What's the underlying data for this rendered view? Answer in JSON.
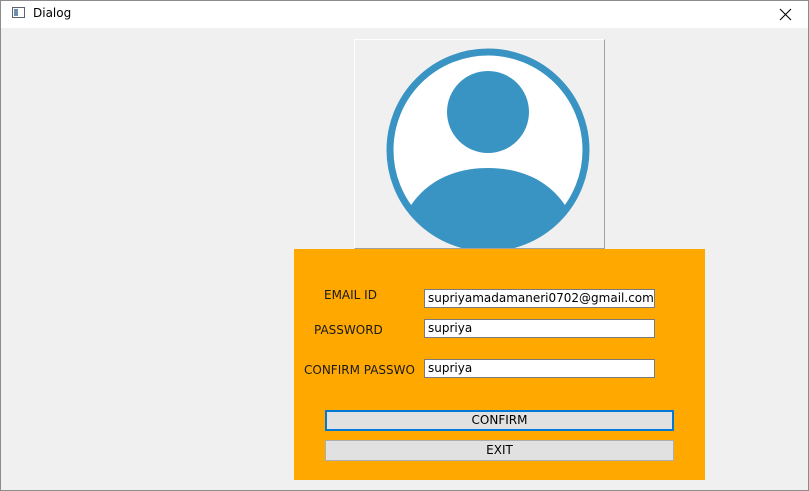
{
  "window": {
    "title": "Dialog",
    "close_glyph": "close-icon"
  },
  "avatar": {
    "icon": "user-avatar-icon",
    "color": "#3a94c3"
  },
  "form": {
    "background": "#ffa800",
    "email_label": "EMAIL ID",
    "email_value": "supriyamadamaneri0702@gmail.com",
    "password_label": "PASSWORD",
    "password_value": "supriya",
    "confirm_label": "CONFIRM PASSWORD",
    "confirm_value": "supriya",
    "confirm_button": "CONFIRM",
    "exit_button": "EXIT"
  }
}
